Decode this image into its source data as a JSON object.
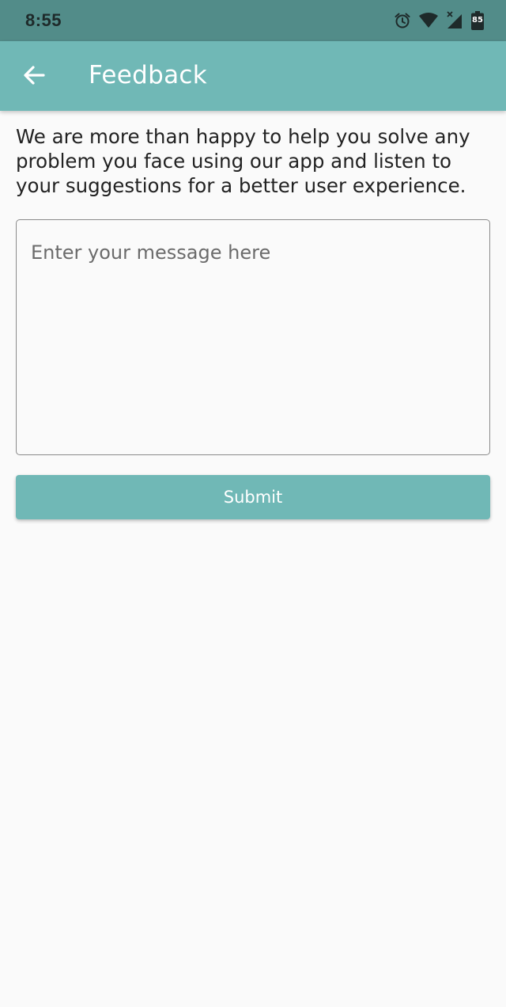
{
  "status_bar": {
    "time": "8:55",
    "battery_level": "85",
    "icons": [
      "alarm-icon",
      "wifi-icon",
      "cellular-signal-icon",
      "battery-icon"
    ]
  },
  "app_bar": {
    "back_icon": "arrow-left-icon",
    "title": "Feedback"
  },
  "content": {
    "intro_text": "We are more than happy to help you solve any problem you face using our app and listen to your suggestions for a better user experience.",
    "message_placeholder": "Enter your message here",
    "message_value": "",
    "submit_label": "Submit"
  },
  "colors": {
    "status_bar": "#528c89",
    "primary": "#70b8b6",
    "background": "#fafafa",
    "text": "#222222"
  }
}
